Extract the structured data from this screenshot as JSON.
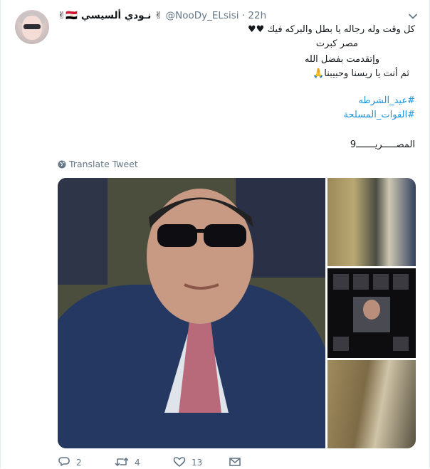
{
  "author": {
    "display_name": "✌🇪🇬 نـودي ألسيسي ✌",
    "handle": "@NooDy_ELsisi",
    "separator": "·",
    "time": "22h"
  },
  "tweet": {
    "line1": "كل وقت وله رجاله يا بطل والبركه فيك ♥♥",
    "line2": "مصر كبرت",
    "line3": "وإتقدمت بفضل الله",
    "line4": "ثم أنت يا ريسنا وحبيبنا🙏",
    "hashtag1": "#عيد_الشرطه",
    "hashtag2": "#القوات_المسلحة",
    "signature": "المصـــــريـــــــ9"
  },
  "translate_label": "Translate Tweet",
  "actions": {
    "reply_count": "2",
    "retweet_count": "4",
    "like_count": "13"
  },
  "colors": {
    "link": "#1b95e0",
    "muted": "#657786",
    "heart": "#e0245e"
  },
  "icons": [
    "caret-down-icon",
    "globe-icon",
    "reply-icon",
    "retweet-icon",
    "heart-icon",
    "mail-icon"
  ]
}
